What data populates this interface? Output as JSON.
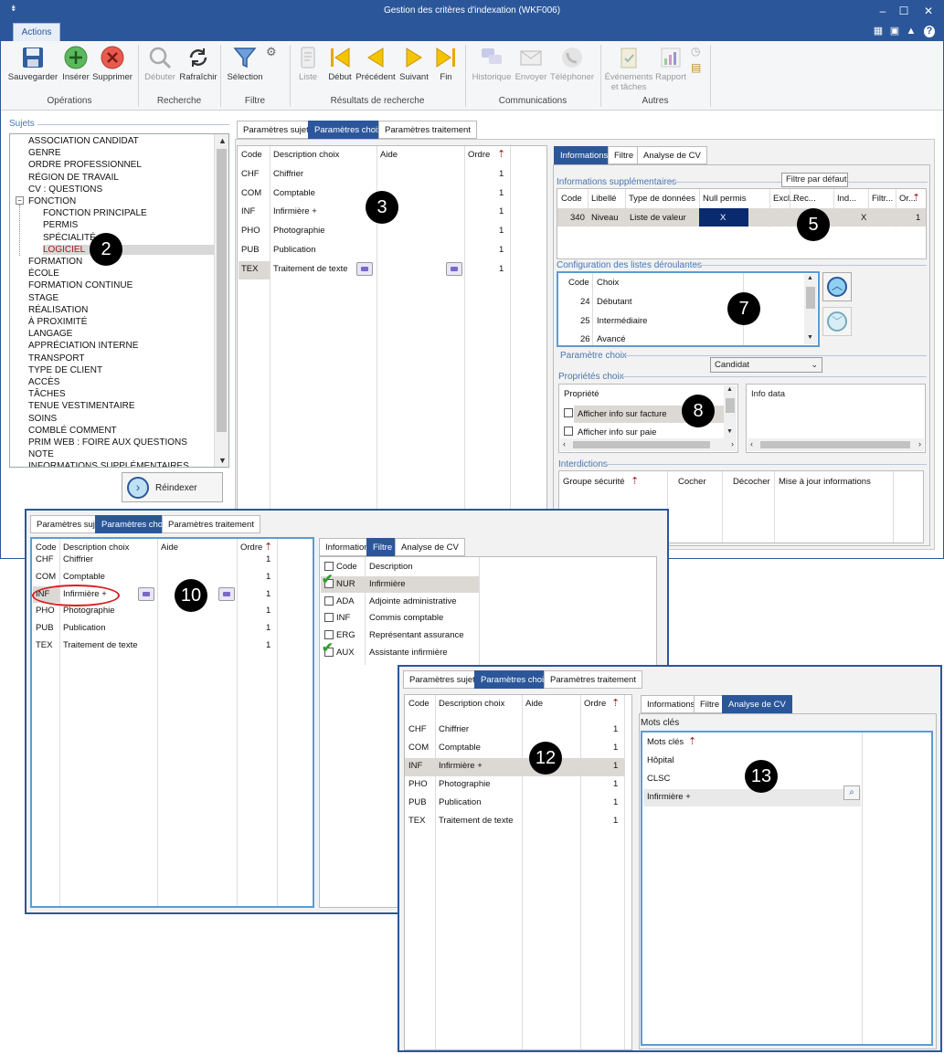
{
  "window": {
    "title": "Gestion des critères d'indexation (WKF006)"
  },
  "ribbon": {
    "tab_actions": "Actions",
    "buttons": {
      "save": "Sauvegarder",
      "insert": "Insérer",
      "delete": "Supprimer",
      "start": "Débuter",
      "refresh": "Rafraîchir",
      "selection": "Sélection",
      "list": "Liste",
      "first": "Début",
      "previous": "Précédent",
      "next": "Suivant",
      "last": "Fin",
      "history": "Historique",
      "send": "Envoyer",
      "phone": "Téléphoner",
      "events": "Événements",
      "events2": "et tâches",
      "report": "Rapport"
    },
    "groups": {
      "operations": "Opérations",
      "search": "Recherche",
      "filter": "Filtre",
      "results": "Résultats de recherche",
      "communications": "Communications",
      "other": "Autres"
    }
  },
  "left": {
    "section_label": "Sujets",
    "tree": [
      "ASSOCIATION CANDIDAT",
      "GENRE",
      "ORDRE PROFESSIONNEL",
      "RÉGION DE TRAVAIL",
      "CV : QUESTIONS",
      "FONCTION",
      "FONCTION PRINCIPALE",
      "PERMIS",
      "SPÉCIALITÉ",
      "LOGICIEL",
      "FORMATION",
      "ÉCOLE",
      "FORMATION CONTINUE",
      "STAGE",
      "RÉALISATION",
      "À PROXIMITÉ",
      "LANGAGE",
      "APPRÉCIATION INTERNE",
      "TRANSPORT",
      "TYPE DE CLIENT",
      "ACCÈS",
      "TÂCHES",
      "TENUE VESTIMENTAIRE",
      "SOINS",
      "COMBLÉ COMMENT",
      "PRIM WEB : FOIRE AUX QUESTIONS",
      "NOTE",
      "INFORMATIONS SUPPLÉMENTAIRES"
    ],
    "reindex": "Réindexer"
  },
  "tabs": {
    "subjects": "Paramètres sujets",
    "choices": "Paramètres choix",
    "processing": "Paramètres traitement"
  },
  "choices_grid": {
    "headers": {
      "code": "Code",
      "desc": "Description choix",
      "help": "Aide",
      "order": "Ordre"
    },
    "rows": [
      {
        "code": "CHF",
        "desc": "Chiffrier",
        "order": "1"
      },
      {
        "code": "COM",
        "desc": "Comptable",
        "order": "1"
      },
      {
        "code": "INF",
        "desc": "Infirmière +",
        "order": "1"
      },
      {
        "code": "PHO",
        "desc": "Photographie",
        "order": "1"
      },
      {
        "code": "PUB",
        "desc": "Publication",
        "order": "1"
      },
      {
        "code": "TEX",
        "desc": "Traitement de texte",
        "order": "1"
      }
    ]
  },
  "right": {
    "tabs": {
      "info": "Informations",
      "filter": "Filtre",
      "cv": "Analyse de CV"
    },
    "extra_info_label": "Informations supplémentaires",
    "default_filter": "Filtre par défaut",
    "extra_headers": [
      "Code",
      "Libellé",
      "Type de données",
      "Null permis",
      "Excl...",
      "Rec...",
      "Ind...",
      "Filtr...",
      "Or..."
    ],
    "extra_row": {
      "code": "340",
      "label": "Niveau",
      "type": "Liste de valeur",
      "null": "X",
      "filter": "X",
      "order": "1"
    },
    "dropdown_label": "Configuration des listes déroulantes",
    "dropdown_headers": {
      "code": "Code",
      "choice": "Choix"
    },
    "dropdown_rows": [
      {
        "code": "24",
        "choice": "Débutant"
      },
      {
        "code": "25",
        "choice": "Intermédiaire"
      },
      {
        "code": "26",
        "choice": "Avancé"
      }
    ],
    "param_choice_label": "Paramètre choix",
    "param_choice_value": "Candidat",
    "props_label": "Propriétés choix",
    "props_header": "Propriété",
    "props_items": [
      "Afficher info sur facture",
      "Afficher info sur paie"
    ],
    "info_data": "Info data",
    "interdictions_label": "Interdictions",
    "interdictions_headers": [
      "Groupe sécurité",
      "Cocher",
      "Décocher",
      "Mise à jour informations"
    ]
  },
  "filter_panel": {
    "headers": {
      "code": "Code",
      "desc": "Description"
    },
    "rows": [
      {
        "code": "NUR",
        "desc": "Infirmière",
        "checked": true
      },
      {
        "code": "ADA",
        "desc": "Adjointe administrative",
        "checked": false
      },
      {
        "code": "INF",
        "desc": "Commis comptable",
        "checked": false
      },
      {
        "code": "ERG",
        "desc": "Représentant assurance",
        "checked": false
      },
      {
        "code": "AUX",
        "desc": "Assistante infirmière",
        "checked": true
      }
    ]
  },
  "cv_panel": {
    "label": "Mots clés",
    "header": "Mots clés",
    "rows": [
      "Hôpital",
      "CLSC",
      "Infirmière +"
    ]
  },
  "badges": {
    "b2": "2",
    "b3": "3",
    "b5": "5",
    "b7": "7",
    "b8": "8",
    "b10": "10",
    "b12": "12",
    "b13": "13"
  },
  "colors": {
    "accent": "#2b579a",
    "selected_blue": "#0a2a6e",
    "highlight_red": "#d62020"
  }
}
